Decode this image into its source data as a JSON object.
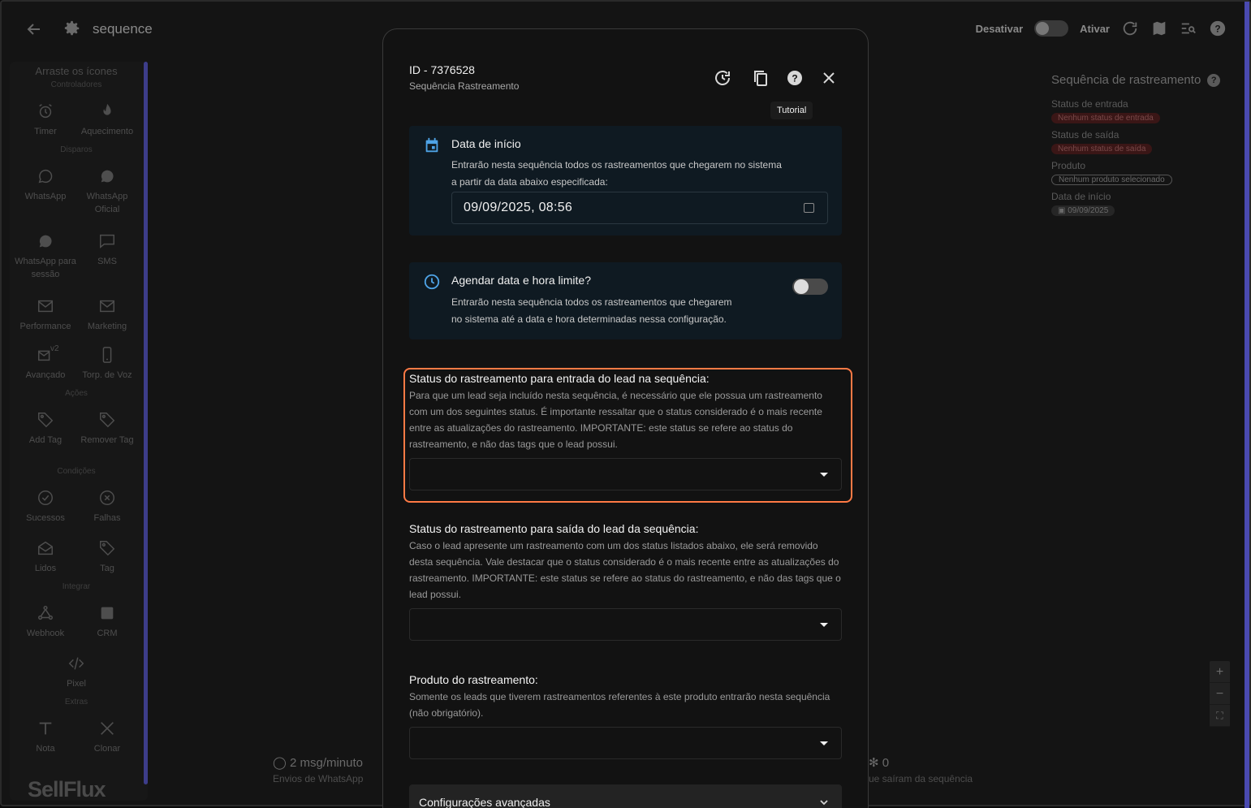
{
  "header": {
    "title": "sequence",
    "deactivate_label": "Desativar",
    "activate_label": "Ativar"
  },
  "palette": {
    "heading": "Arraste os ícones",
    "sections": {
      "controllers": "Controladores",
      "shots": "Disparos",
      "actions": "Ações",
      "conditions": "Condições",
      "integrate": "Integrar",
      "extras": "Extras"
    },
    "items": {
      "timer": "Timer",
      "warmup": "Aquecimento",
      "whatsapp": "WhatsApp",
      "whatsapp_official": "WhatsApp Oficial",
      "whatsapp_session": "WhatsApp para sessão",
      "sms": "SMS",
      "performance": "Performance",
      "marketing": "Marketing",
      "advanced": "Avançado",
      "voice": "Torp. de Voz",
      "add_tag": "Add Tag",
      "remove_tag": "Remover Tag",
      "successes": "Sucessos",
      "failures": "Falhas",
      "read": "Lidos",
      "tag": "Tag",
      "webhook": "Webhook",
      "crm": "CRM",
      "pixel": "Pixel",
      "note": "Nota",
      "clone": "Clonar",
      "advanced_badge": "v2"
    },
    "brand": "SellFlux"
  },
  "right_panel": {
    "title": "Sequência de rastreamento",
    "help": "?",
    "entry_label": "Status de entrada",
    "entry_value": "Nenhum status de entrada",
    "exit_label": "Status de saída",
    "exit_value": "Nenhum status de saída",
    "product_label": "Produto",
    "product_value": "Nenhum produto selecionado",
    "start_label": "Data de início",
    "start_value": "09/09/2025"
  },
  "stats": {
    "rate_value": "2 msg/minuto",
    "rate_label": "Envios de WhatsApp",
    "left_value": "0",
    "left_label": "ue saíram da sequência"
  },
  "zoom": {
    "in": "+",
    "out": "−"
  },
  "modal": {
    "id": "ID - 7376528",
    "subtitle": "Sequência Rastreamento",
    "tooltip": "Tutorial",
    "start_card": {
      "title": "Data de início",
      "desc_line1": "Entrarão nesta sequência todos os rastreamentos que chegarem no sistema",
      "desc_line2": "a partir da data abaixo especificada:",
      "value": "09/09/2025, 08:56"
    },
    "limit_card": {
      "title": "Agendar data e hora limite?",
      "desc_line1": "Entrarão nesta sequência todos os rastreamentos que chegarem",
      "desc_line2": "no sistema até a data e hora determinadas nessa configuração.",
      "enabled": false
    },
    "entry_status": {
      "title": "Status do rastreamento para entrada do lead na sequência:",
      "desc": "Para que um lead seja incluído nesta sequência, é necessário que ele possua um rastreamento com um dos seguintes status. É importante ressaltar que o status considerado é o mais recente entre as atualizações do rastreamento. IMPORTANTE: este status se refere ao status do rastreamento, e não das tags que o lead possui.",
      "value": ""
    },
    "exit_status": {
      "title": "Status do rastreamento para saída do lead da sequência:",
      "desc": "Caso o lead apresente um rastreamento com um dos status listados abaixo, ele será removido desta sequência. Vale destacar que o status considerado é o mais recente entre as atualizações do rastreamento. IMPORTANTE: este status se refere ao status do rastreamento, e não das tags que o lead possui.",
      "value": ""
    },
    "product": {
      "title": "Produto do rastreamento:",
      "desc": "Somente os leads que tiverem rastreamentos referentes à este produto entrarão nesta sequência (não obrigatório).",
      "value": ""
    },
    "advanced_label": "Configurações avançadas"
  },
  "colors": {
    "accent_blue": "#4ea3e6",
    "highlight_orange": "#ff7a45",
    "status_red_bg": "#3a1616"
  }
}
